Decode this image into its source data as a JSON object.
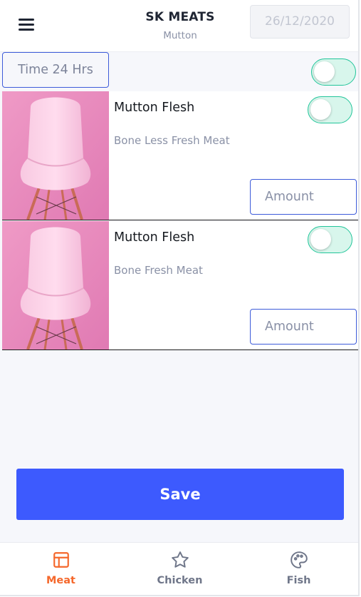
{
  "header": {
    "title": "SK MEATS",
    "subtitle": "Mutton",
    "date": "26/12/2020",
    "menu_icon": "hamburger-menu-icon"
  },
  "time_filter": {
    "label": "Time 24 Hrs",
    "toggle_on": false
  },
  "products": [
    {
      "name": "Mutton Flesh",
      "description": "Bone Less Fresh Meat",
      "amount_placeholder": "Amount",
      "toggle_on": false,
      "image": "pink-chair-photo"
    },
    {
      "name": "Mutton Flesh",
      "description": "Bone Fresh Meat",
      "amount_placeholder": "Amount",
      "toggle_on": false,
      "image": "pink-chair-photo"
    }
  ],
  "save_label": "Save",
  "nav": {
    "items": [
      {
        "label": "Meat",
        "icon": "layout-icon",
        "active": true
      },
      {
        "label": "Chicken",
        "icon": "star-icon",
        "active": false
      },
      {
        "label": "Fish",
        "icon": "palette-icon",
        "active": false
      }
    ]
  },
  "colors": {
    "primary": "#3d5afe",
    "input_border": "#3d5bd9",
    "toggle_border": "#22c59a",
    "toggle_fill": "#d8f6ec",
    "nav_active": "#f5682c",
    "nav_inactive": "#6f7689",
    "background": "#f6f7fb"
  }
}
